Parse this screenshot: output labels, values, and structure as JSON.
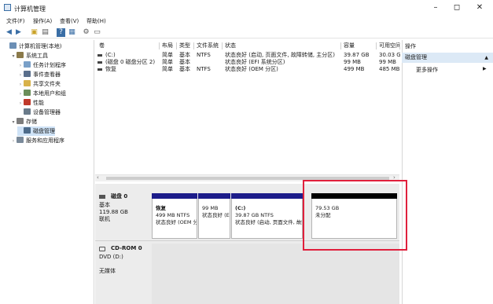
{
  "window": {
    "title": "计算机管理",
    "minimize_glyph": "–",
    "maximize_glyph": "◻",
    "close_glyph": "✕"
  },
  "menu": [
    "文件(F)",
    "操作(A)",
    "查看(V)",
    "帮助(H)"
  ],
  "tree": [
    {
      "label": "计算机管理(本地)",
      "indent": 0,
      "exp": "",
      "icon": "computer-icon",
      "color": "#6c8fb5"
    },
    {
      "label": "系统工具",
      "indent": 1,
      "exp": "▾",
      "icon": "tools-icon",
      "color": "#8b7a4a"
    },
    {
      "label": "任务计划程序",
      "indent": 2,
      "exp": "›",
      "icon": "clock-icon",
      "color": "#7aa0c8"
    },
    {
      "label": "事件查看器",
      "indent": 2,
      "exp": "›",
      "icon": "event-viewer-icon",
      "color": "#5a6f8c"
    },
    {
      "label": "共享文件夹",
      "indent": 2,
      "exp": "›",
      "icon": "shared-folder-icon",
      "color": "#d8b24a"
    },
    {
      "label": "本地用户和组",
      "indent": 2,
      "exp": "›",
      "icon": "users-icon",
      "color": "#6b8e5a"
    },
    {
      "label": "性能",
      "indent": 2,
      "exp": "›",
      "icon": "performance-icon",
      "color": "#c0392b"
    },
    {
      "label": "设备管理器",
      "indent": 2,
      "exp": "",
      "icon": "device-manager-icon",
      "color": "#6a7b8a"
    },
    {
      "label": "存储",
      "indent": 1,
      "exp": "▾",
      "icon": "storage-icon",
      "color": "#7d7d7d"
    },
    {
      "label": "磁盘管理",
      "indent": 2,
      "exp": "",
      "icon": "disk-management-icon",
      "color": "#4d6b8a",
      "selected": true
    },
    {
      "label": "服务和应用程序",
      "indent": 1,
      "exp": "›",
      "icon": "services-icon",
      "color": "#7a8a9a"
    }
  ],
  "volumes": {
    "headers": [
      "卷",
      "布局",
      "类型",
      "文件系统",
      "状态",
      "容量",
      "可用空间"
    ],
    "rows": [
      [
        "(C:)",
        "简单",
        "基本",
        "NTFS",
        "状态良好 (启动, 页面文件, 故障转储, 主分区)",
        "39.87 GB",
        "30.03 GB"
      ],
      [
        "(磁盘 0 磁盘分区 2)",
        "简单",
        "基本",
        "",
        "状态良好 (EFI 系统分区)",
        "99 MB",
        "99 MB"
      ],
      [
        "恢复",
        "简单",
        "基本",
        "NTFS",
        "状态良好 (OEM 分区)",
        "499 MB",
        "485 MB"
      ]
    ]
  },
  "disk0": {
    "name": "磁盘 0",
    "type": "基本",
    "size": "119.88 GB",
    "status": "联机",
    "partitions": [
      {
        "name": "恢复",
        "line1": "499 MB NTFS",
        "line2": "状态良好 (OEM 分区)"
      },
      {
        "name": "",
        "line1": "99 MB",
        "line2": "状态良好 (EFI 系统分区)"
      },
      {
        "name": "(C:)",
        "line1": "39.87 GB NTFS",
        "line2": "状态良好 (启动, 页面文件, 故障转储, 主分区)"
      },
      {
        "name": "",
        "line1": "79.53 GB",
        "line2": "未分配"
      }
    ]
  },
  "cdrom0": {
    "name": "CD-ROM 0",
    "line1": "DVD (D:)",
    "line2": "无媒体"
  },
  "actions": {
    "title": "操作",
    "section": "磁盘管理",
    "more": "更多操作"
  },
  "colors": {
    "primary_partition": "#1c1c8a",
    "unallocated": "#000000",
    "selection": "#cfe3f7",
    "highlight": "#e0203c"
  }
}
